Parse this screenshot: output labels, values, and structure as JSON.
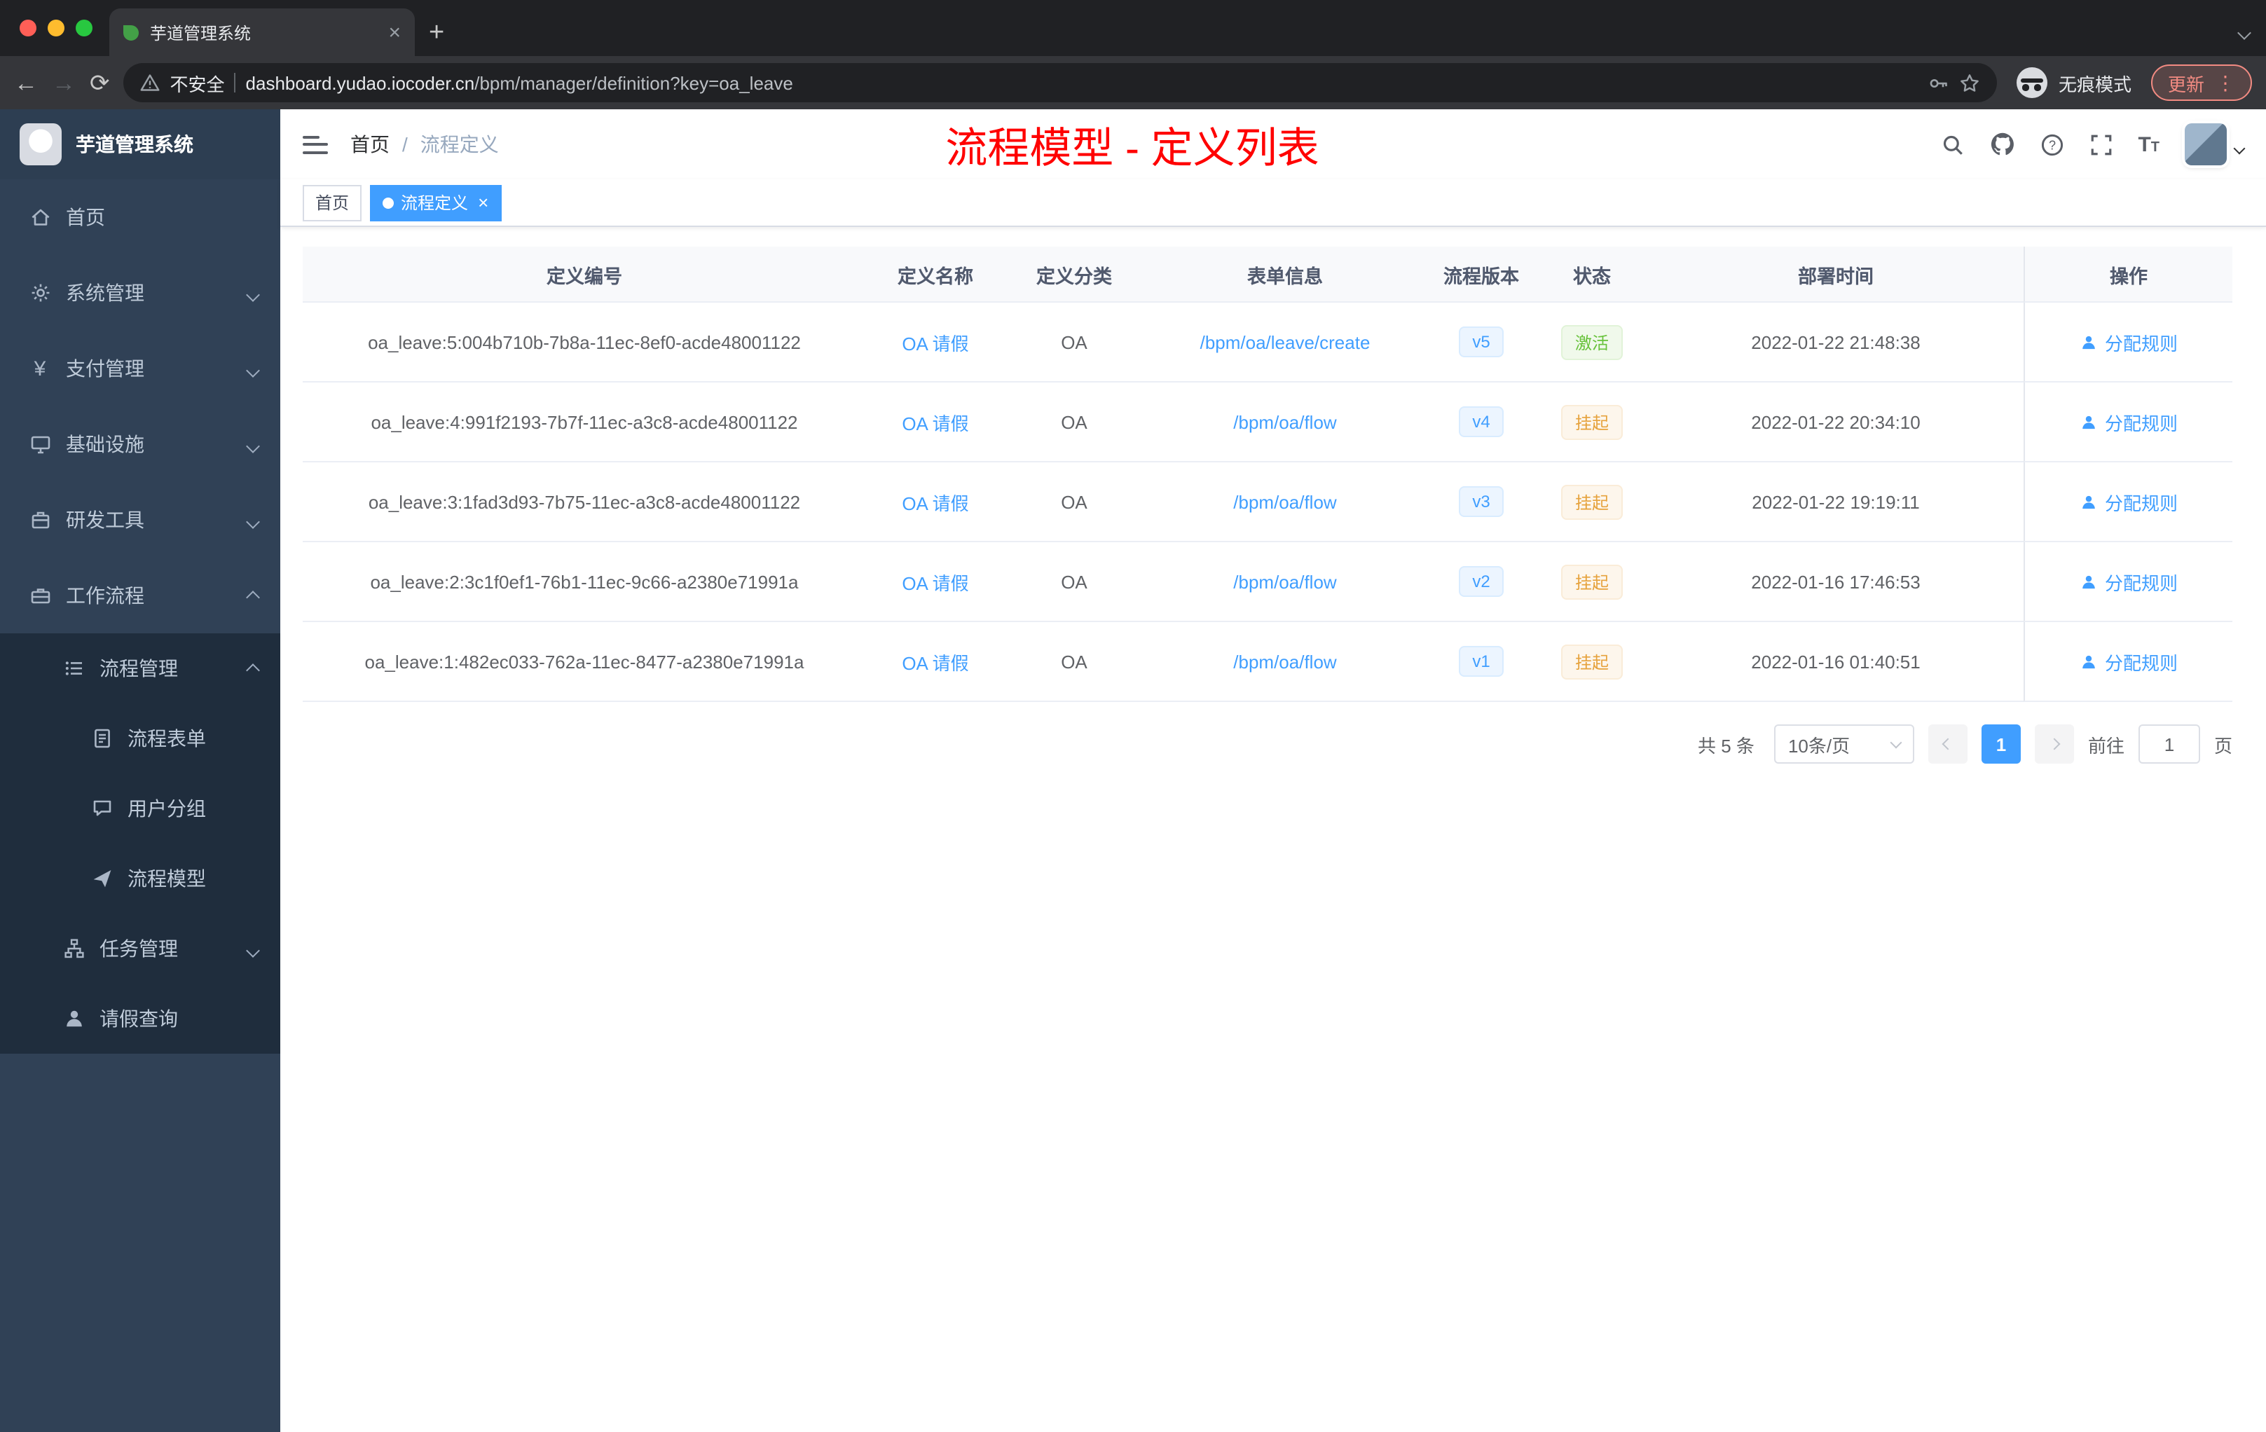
{
  "colors": {
    "accent": "#409eff",
    "success": "#67c23a",
    "warning": "#e6a23c",
    "annotation_red": "#ff0000",
    "sidebar_bg": "#304156",
    "submenu_bg": "#1f2d3d"
  },
  "browser": {
    "tab_title": "芋道管理系统",
    "security_label": "不安全",
    "url_host": "dashboard.yudao.iocoder.cn",
    "url_path": "/bpm/manager/definition?key=oa_leave",
    "incognito_label": "无痕模式",
    "update_label": "更新"
  },
  "sidebar": {
    "app_title": "芋道管理系统",
    "menu": [
      {
        "label": "首页"
      },
      {
        "label": "系统管理"
      },
      {
        "label": "支付管理"
      },
      {
        "label": "基础设施"
      },
      {
        "label": "研发工具"
      },
      {
        "label": "工作流程"
      },
      {
        "label": "流程管理"
      },
      {
        "label": "流程表单"
      },
      {
        "label": "用户分组"
      },
      {
        "label": "流程模型"
      },
      {
        "label": "任务管理"
      },
      {
        "label": "请假查询"
      }
    ]
  },
  "header": {
    "breadcrumb_home": "首页",
    "breadcrumb_sep": "/",
    "breadcrumb_current": "流程定义",
    "annotation": "流程模型 - 定义列表"
  },
  "tags": {
    "home": "首页",
    "active": "流程定义"
  },
  "table": {
    "columns": {
      "id": "定义编号",
      "name": "定义名称",
      "category": "定义分类",
      "form": "表单信息",
      "version": "流程版本",
      "status": "状态",
      "deploy_time": "部署时间",
      "actions": "操作"
    },
    "action_label": "分配规则",
    "rows": [
      {
        "id": "oa_leave:5:004b710b-7b8a-11ec-8ef0-acde48001122",
        "name": "OA 请假",
        "category": "OA",
        "form": "/bpm/oa/leave/create",
        "version": "v5",
        "status": "激活",
        "status_type": "success",
        "deploy_time": "2022-01-22 21:48:38"
      },
      {
        "id": "oa_leave:4:991f2193-7b7f-11ec-a3c8-acde48001122",
        "name": "OA 请假",
        "category": "OA",
        "form": "/bpm/oa/flow",
        "version": "v4",
        "status": "挂起",
        "status_type": "warning",
        "deploy_time": "2022-01-22 20:34:10"
      },
      {
        "id": "oa_leave:3:1fad3d93-7b75-11ec-a3c8-acde48001122",
        "name": "OA 请假",
        "category": "OA",
        "form": "/bpm/oa/flow",
        "version": "v3",
        "status": "挂起",
        "status_type": "warning",
        "deploy_time": "2022-01-22 19:19:11"
      },
      {
        "id": "oa_leave:2:3c1f0ef1-76b1-11ec-9c66-a2380e71991a",
        "name": "OA 请假",
        "category": "OA",
        "form": "/bpm/oa/flow",
        "version": "v2",
        "status": "挂起",
        "status_type": "warning",
        "deploy_time": "2022-01-16 17:46:53"
      },
      {
        "id": "oa_leave:1:482ec033-762a-11ec-8477-a2380e71991a",
        "name": "OA 请假",
        "category": "OA",
        "form": "/bpm/oa/flow",
        "version": "v1",
        "status": "挂起",
        "status_type": "warning",
        "deploy_time": "2022-01-16 01:40:51"
      }
    ]
  },
  "pagination": {
    "total": "共 5 条",
    "page_size": "10条/页",
    "current_page": "1",
    "goto_label": "前往",
    "goto_value": "1",
    "page_unit": "页"
  }
}
